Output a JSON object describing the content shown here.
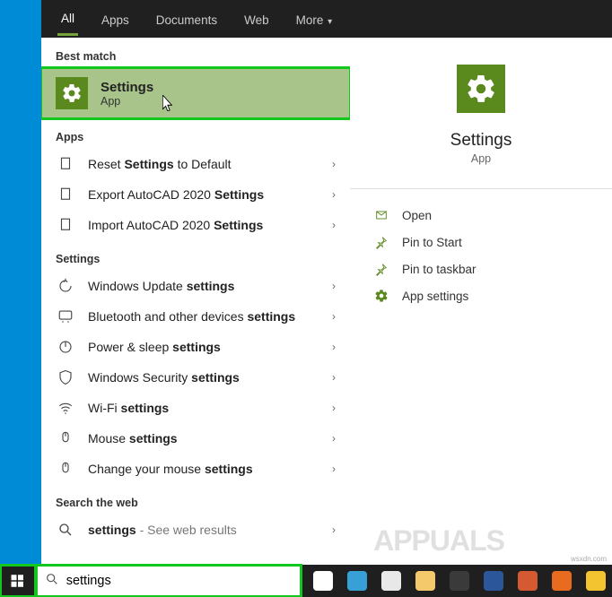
{
  "tabs": {
    "all": "All",
    "apps": "Apps",
    "documents": "Documents",
    "web": "Web",
    "more": "More"
  },
  "sections": {
    "best_match": "Best match",
    "apps": "Apps",
    "settings": "Settings",
    "web": "Search the web"
  },
  "best_match": {
    "title": "Settings",
    "subtitle": "App"
  },
  "apps_results": [
    {
      "pre": "Reset ",
      "bold": "Settings",
      "post": " to Default",
      "icon": "reset"
    },
    {
      "pre": "Export AutoCAD 2020 ",
      "bold": "Settings",
      "post": "",
      "icon": "export"
    },
    {
      "pre": "Import AutoCAD 2020 ",
      "bold": "Settings",
      "post": "",
      "icon": "import"
    }
  ],
  "settings_results": [
    {
      "pre": "Windows Update ",
      "bold": "settings",
      "icon": "update"
    },
    {
      "pre": "Bluetooth and other devices ",
      "bold": "settings",
      "icon": "bluetooth"
    },
    {
      "pre": "Power & sleep ",
      "bold": "settings",
      "icon": "power"
    },
    {
      "pre": "Windows Security ",
      "bold": "settings",
      "icon": "shield"
    },
    {
      "pre": "Wi-Fi ",
      "bold": "settings",
      "icon": "wifi"
    },
    {
      "pre": "Mouse ",
      "bold": "settings",
      "icon": "mouse"
    },
    {
      "pre": "Change your mouse ",
      "bold": "settings",
      "icon": "mouse"
    }
  ],
  "web_results": [
    {
      "bold": "settings",
      "dim": " - See web results",
      "icon": "search"
    }
  ],
  "right": {
    "title": "Settings",
    "subtitle": "App"
  },
  "actions": {
    "open": "Open",
    "pin_start": "Pin to Start",
    "pin_taskbar": "Pin to taskbar",
    "app_settings": "App settings"
  },
  "search": {
    "value": "settings"
  },
  "taskbar_icons": [
    {
      "name": "cortana",
      "color": "#ffffff"
    },
    {
      "name": "edge",
      "color": "#37a0d6"
    },
    {
      "name": "chrome",
      "color": "#e8e8e8"
    },
    {
      "name": "file-explorer",
      "color": "#f3c96b"
    },
    {
      "name": "store",
      "color": "#3a3a3a"
    },
    {
      "name": "calculator",
      "color": "#2b579a"
    },
    {
      "name": "snip",
      "color": "#d65a31"
    },
    {
      "name": "app1",
      "color": "#e86b1f"
    },
    {
      "name": "app2",
      "color": "#f4c430"
    }
  ],
  "watermark": "APPUALS",
  "watermark_small": "wsxdn.com"
}
